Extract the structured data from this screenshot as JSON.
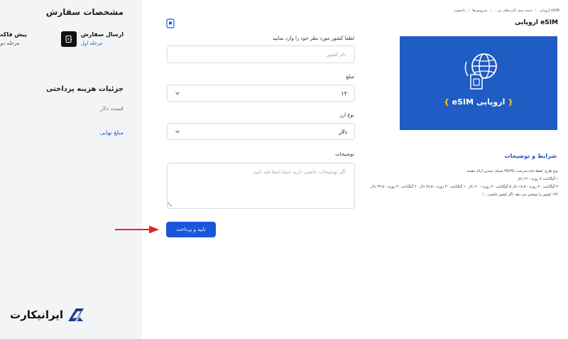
{
  "order": {
    "title": "مشخصات سفارش",
    "steps": [
      {
        "name": "ارسال سفارش",
        "sub": "مرحله اول"
      },
      {
        "name": "پیش فاکت",
        "sub": "مرحله دوم"
      }
    ]
  },
  "payment": {
    "title": "جزئیات هزینه پرداختی",
    "dollar_price_label": "قیمت دلار",
    "final_amount_label": "مبلغ نهایی"
  },
  "logo": {
    "text": "ایرانیکارت"
  },
  "form": {
    "country_label": "لطفا کشور مورد نظر خود را وارد نمایید",
    "country_placeholder": "نام کشور",
    "amount_label": "مبلغ",
    "amount_value": "۱۲",
    "currency_label": "نوع ارز",
    "currency_value": "دلار",
    "description_label": "توضیحات",
    "description_placeholder": "اگر توضیحات خاصی دارید حتما اینجا قید کنید.",
    "submit_label": "تایید و پرداخت"
  },
  "breadcrumb": [
    "داشبورد",
    "سرویس‌ها",
    "دسته سیم کارت‌های بی...",
    "eSIM اروپایی"
  ],
  "product": {
    "title": "eSIM اروپایی",
    "image_label": "eSIM اروپایی"
  },
  "terms": {
    "title": "شرایط و توضیحات",
    "lines": [
      "نوع طرح: فقط داده سرعت: ۳G/۴G شبکه: چندین ارائه دهنده",
      "۱ گیگابایت ۷ روزه – ۱۲ دلار",
      "۳ گیگابایت ۳۰ روزه – ۱۷.۵ دلار ۵ گیگابایت ۳۰ روزه – ۲۰ دلار ۱۰ گیگابایت ۳۰ روزه – ۲۸.۵ دلار ۲۰ گیگابایت ۳۰ روزه – ۴۳.۵ دلار",
      "۱۳۶ کشور را پوشش می دهد. اگر کشور خاصی..."
    ]
  },
  "colors": {
    "accent": "#1a56db",
    "product_bg": "#1f5cc4",
    "brace_yellow": "#f5c518",
    "arrow": "#e0262b"
  }
}
